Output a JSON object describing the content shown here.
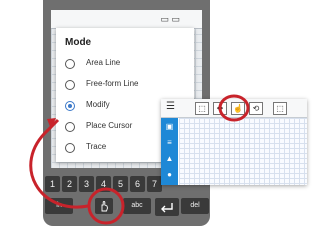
{
  "dialog": {
    "title": "Mode",
    "options": [
      {
        "label": "Area Line",
        "selected": false
      },
      {
        "label": "Free-form Line",
        "selected": false
      },
      {
        "label": "Modify",
        "selected": true
      },
      {
        "label": "Place Cursor",
        "selected": false
      },
      {
        "label": "Trace",
        "selected": false
      }
    ]
  },
  "keypad": {
    "numbers": [
      "1",
      "2",
      "3",
      "4",
      "5",
      "6",
      "7"
    ],
    "fn_label": "fn",
    "ab_label": "abc",
    "del_label": "del",
    "hand_icon": "hand-pointer-icon",
    "enter_icon": "enter-icon"
  },
  "graph_panel": {
    "menu_icon": "hamburger-menu-icon",
    "tools": [
      "zoom-box-icon",
      "pan-icon",
      "hand-pointer-icon",
      "zoom-fit-icon",
      "zoom-out-icon"
    ],
    "sidebar_icons": [
      "briefcase-icon",
      "list-icon",
      "stats-icon",
      "location-pin-icon"
    ]
  },
  "annotation": {
    "accent": "#c8232b"
  }
}
